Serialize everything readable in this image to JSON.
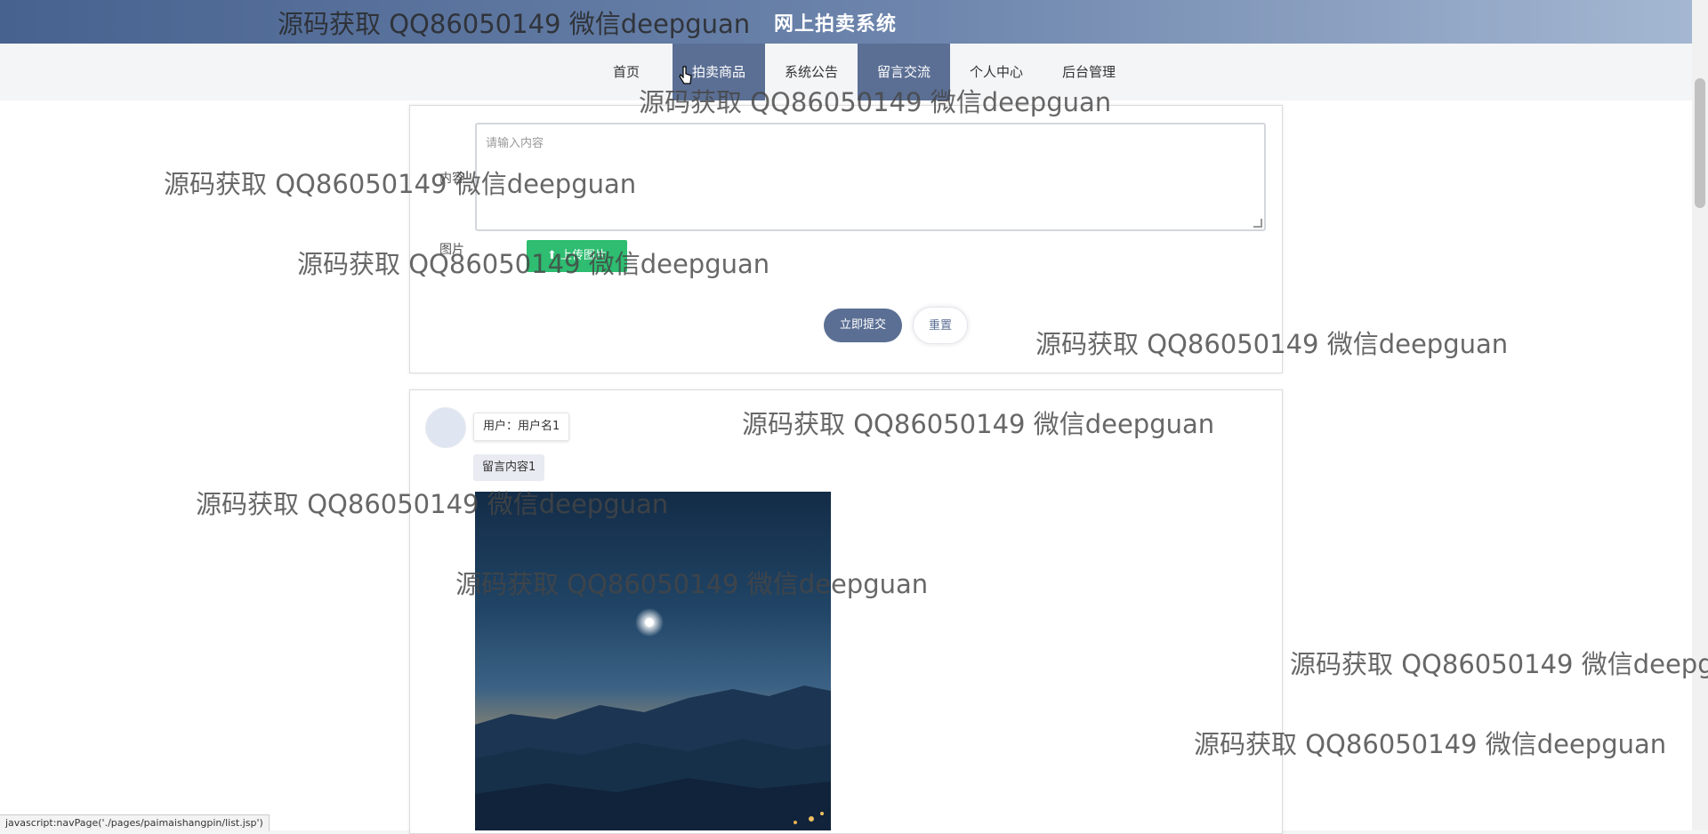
{
  "header": {
    "title": "网上拍卖系统"
  },
  "nav": {
    "items": [
      "首页",
      "拍卖商品",
      "系统公告",
      "留言交流",
      "个人中心",
      "后台管理"
    ]
  },
  "form": {
    "content_label": "内容",
    "textarea_placeholder": "请输入内容",
    "image_label": "图片",
    "upload_label": "上传图片",
    "submit_label": "立即提交",
    "reset_label": "重置"
  },
  "message": {
    "user_label": "用户：用户名1",
    "content": "留言内容1"
  },
  "status_bar": "javascript:navPage('./pages/paimaishangpin/list.jsp')",
  "watermark": "源码获取 QQ86050149 微信deepguan",
  "colors": {
    "header_start": "#47628f",
    "accent": "#5b6f94",
    "upload_green": "#2ebd71"
  }
}
